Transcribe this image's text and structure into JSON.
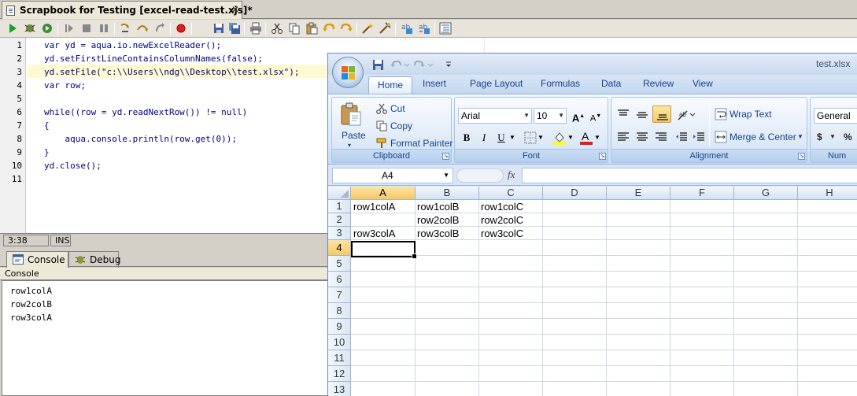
{
  "ide": {
    "tab_title": "Scrapbook for Testing [excel-read-test.xjs]*",
    "tab_close": "✕",
    "line_numbers": [
      "1",
      "2",
      "3",
      "4",
      "5",
      "6",
      "7",
      "8",
      "9",
      "10",
      "11"
    ],
    "code_lines": [
      "var yd = aqua.io.newExcelReader();",
      "yd.setFirstLineContainsColumnNames(false);",
      "yd.setFile(\"c:\\\\Users\\\\ndg\\\\Desktop\\\\test.xlsx\");",
      "var row;",
      "",
      "while((row = yd.readNextRow()) != null)",
      "{",
      "    aqua.console.println(row.get(0));",
      "}",
      "yd.close();",
      ""
    ],
    "status_position": "3:38",
    "status_mode": "INS",
    "console_tab": "Console",
    "debug_tab": "Debug",
    "console_label": "Console",
    "console_output": [
      "row1colA",
      "row2colB",
      "row3colA"
    ]
  },
  "excel": {
    "window_title": "test.xlsx",
    "ribbon_tabs": [
      "Home",
      "Insert",
      "Page Layout",
      "Formulas",
      "Data",
      "Review",
      "View"
    ],
    "clipboard": {
      "paste": "Paste",
      "cut": "Cut",
      "copy": "Copy",
      "format_painter": "Format Painter",
      "group": "Clipboard"
    },
    "font": {
      "name": "Arial",
      "size": "10",
      "bold": "B",
      "italic": "I",
      "underline": "U",
      "group": "Font"
    },
    "alignment": {
      "wrap_text": "Wrap Text",
      "merge_center": "Merge & Center",
      "group": "Alignment"
    },
    "number": {
      "format": "General",
      "currency": "$",
      "percent": "%",
      "group": "Num"
    },
    "name_box": "A4",
    "fx": "fx",
    "columns": [
      "A",
      "B",
      "C",
      "D",
      "E",
      "F",
      "G",
      "H"
    ],
    "rows": [
      "1",
      "2",
      "3",
      "4",
      "5",
      "6",
      "7",
      "8",
      "9",
      "10",
      "11",
      "12",
      "13"
    ],
    "cells": {
      "A1": "row1colA",
      "B1": "row1colB",
      "C1": "row1colC",
      "A2": "",
      "B2": "row2colB",
      "C2": "row2colC",
      "A3": "row3colA",
      "B3": "row3colB",
      "C3": "row3colC"
    },
    "selected_cell": "A4"
  }
}
